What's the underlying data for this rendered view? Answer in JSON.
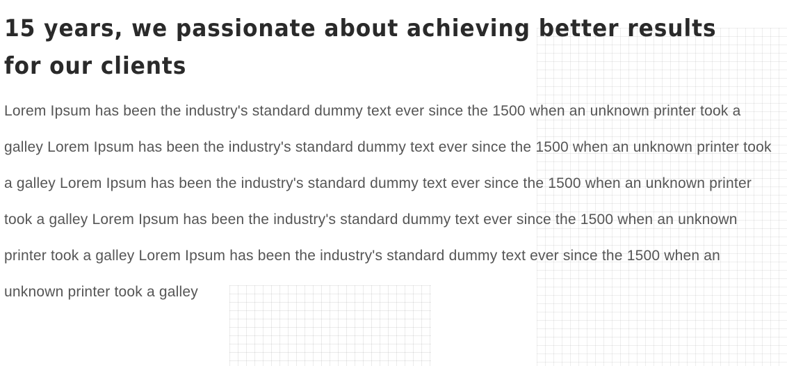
{
  "article": {
    "heading": "15 years, we passionate about achieving better results for our clients",
    "body": "Lorem Ipsum has been the industry's standard dummy text ever since the 1500 when an unknown printer took a galley Lorem Ipsum has been the industry's standard dummy text ever since the 1500 when an unknown printer took a galley Lorem Ipsum has been the industry's standard dummy text ever since the 1500 when an unknown printer took a galley Lorem Ipsum has been the industry's standard dummy text ever since the 1500 when an unknown printer took a galley Lorem Ipsum has been the industry's standard dummy text ever since the 1500 when an unknown printer took a galley"
  }
}
